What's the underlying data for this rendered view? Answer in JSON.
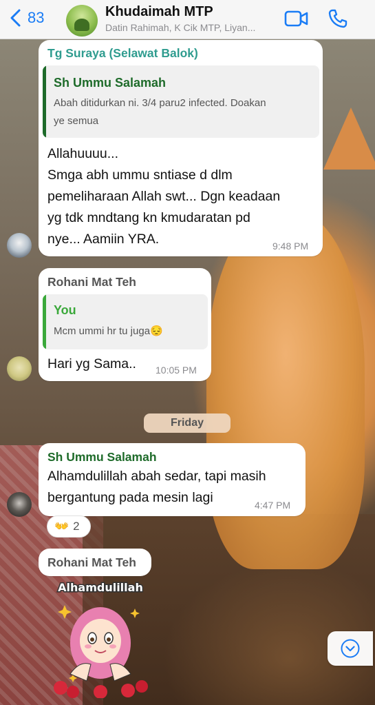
{
  "header": {
    "back_count": "83",
    "title": "Khudaimah MTP",
    "subtitle": "Datin Rahimah, K Cik MTP, Liyan...",
    "icons": {
      "back": "chevron-left-icon",
      "video": "video-camera-icon",
      "call": "phone-icon"
    }
  },
  "messages": [
    {
      "sender": "Tg Suraya (Selawat Balok)",
      "sender_color": "#2f9c8f",
      "quote": {
        "author": "Sh Ummu Salamah",
        "author_color": "#1e6b2a",
        "line1": "Abah ditidurkan ni. 3/4 paru2 infected. Doakan",
        "line2": "ye semua"
      },
      "lines": [
        "Allahuuuu...",
        "Smga abh ummu sntiase d dlm",
        "pemeliharaan Allah swt... Dgn keadaan",
        "yg tdk mndtang kn kmudaratan pd",
        "nye... Aamiin YRA."
      ],
      "time": "9:48 PM"
    },
    {
      "sender": "Rohani Mat Teh",
      "sender_color": "#555555",
      "quote": {
        "author": "You",
        "author_color": "#3aa83a",
        "line1": "Mcm ummi hr tu juga😔"
      },
      "lines": [
        "Hari yg Sama.."
      ],
      "time": "10:05 PM"
    },
    {
      "sender": "Sh Ummu Salamah",
      "sender_color": "#1e6b2a",
      "lines": [
        "Alhamdulillah abah sedar, tapi masih",
        "bergantung pada mesin lagi"
      ],
      "time": "4:47 PM",
      "reaction": {
        "emoji": "👐",
        "count": "2"
      }
    },
    {
      "sender": "Rohani Mat Teh",
      "sender_color": "#555555",
      "sticker_text": "Alhamdulillah"
    }
  ],
  "date_separator": "Friday",
  "scroll_icon": "chevron-down-circle-icon"
}
